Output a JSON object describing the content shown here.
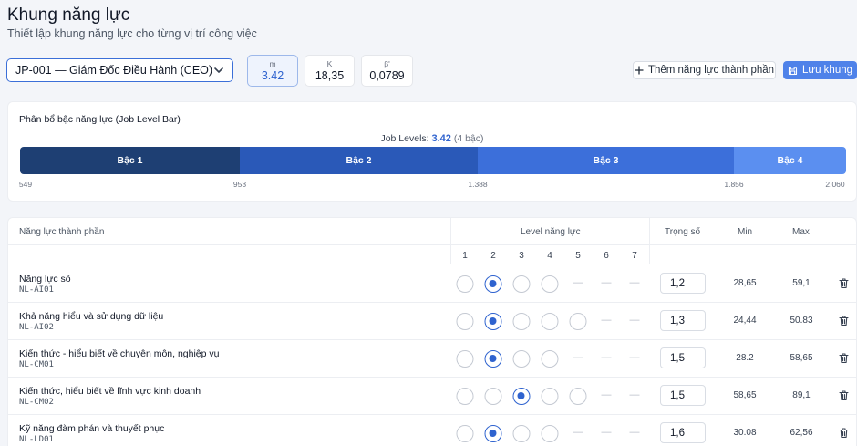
{
  "header": {
    "title": "Khung năng lực",
    "subtitle": "Thiết lập khung năng lực cho từng vị trí công việc"
  },
  "job_select": {
    "value": "JP-001 — Giám Đốc Điều Hành (CEO)"
  },
  "metrics": [
    {
      "label": "m",
      "value": "3.42"
    },
    {
      "label": "K",
      "value": "18,35"
    },
    {
      "label": "β'",
      "value": "0,0789"
    }
  ],
  "actions": {
    "add_label": "Thêm năng lực thành phần",
    "save_label": "Lưu khung"
  },
  "level_bar": {
    "title": "Phân bổ bậc năng lực (Job Level Bar)",
    "caption_prefix": "Job Levels:",
    "caption_value": "3.42",
    "caption_suffix": "(4 bậc)",
    "segments": [
      {
        "label": "Bậc 1",
        "color": "#1e3f73"
      },
      {
        "label": "Bậc 2",
        "color": "#2a59b8"
      },
      {
        "label": "Bậc 3",
        "color": "#3c6fda"
      },
      {
        "label": "Bậc 4",
        "color": "#5b8ff0"
      }
    ],
    "ticks": [
      "549",
      "953",
      "1.388",
      "1.856",
      "2.060"
    ]
  },
  "table": {
    "col_competency": "Năng lực thành phần",
    "col_level": "Level năng lực",
    "col_weight": "Trọng số",
    "col_min": "Min",
    "col_max": "Max",
    "levels": [
      "1",
      "2",
      "3",
      "4",
      "5",
      "6",
      "7"
    ],
    "dash": "—",
    "rows": [
      {
        "name": "Năng lực số",
        "code": "NL-AI01",
        "selected": 2,
        "weight": "1,2",
        "min": "28,65",
        "max": "59,1"
      },
      {
        "name": "Khả năng hiểu và sử dụng dữ liệu",
        "code": "NL-AI02",
        "selected": 2,
        "weight": "1,3",
        "min": "24,44",
        "max": "50.83"
      },
      {
        "name": "Kiến thức - hiểu biết về chuyên môn, nghiệp vụ",
        "code": "NL-CM01",
        "selected": 2,
        "weight": "1,5",
        "min": "28.2",
        "max": "58,65"
      },
      {
        "name": "Kiến thức, hiểu biết về lĩnh vực kinh doanh",
        "code": "NL-CM02",
        "selected": 3,
        "weight": "1,5",
        "min": "58,65",
        "max": "89,1"
      },
      {
        "name": "Kỹ năng đàm phán và thuyết phục",
        "code": "NL-LD01",
        "selected": 2,
        "weight": "1,6",
        "min": "30.08",
        "max": "62,56"
      }
    ]
  }
}
